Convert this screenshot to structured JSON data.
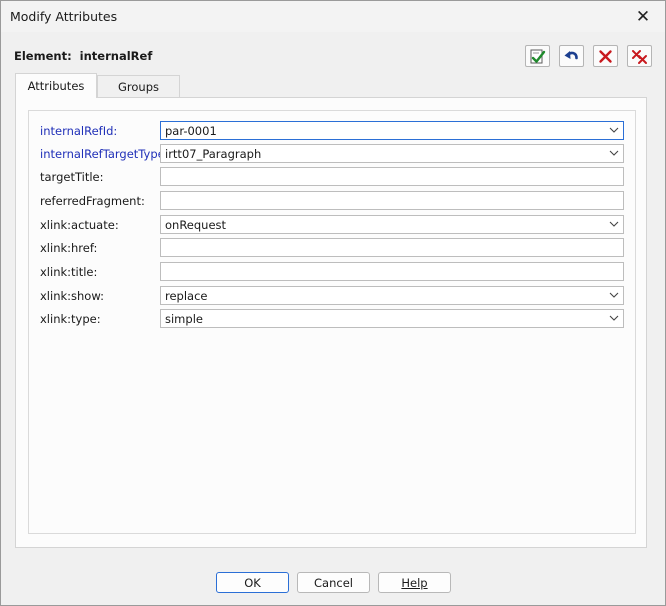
{
  "window": {
    "title": "Modify Attributes",
    "close_glyph": "✕"
  },
  "element": {
    "label": "Element:",
    "name": "internalRef"
  },
  "toolbar": {
    "icons": [
      "check-document-icon",
      "undo-icon",
      "delete-icon",
      "delete-all-icon"
    ]
  },
  "tabs": [
    {
      "label": "Attributes",
      "active": true
    },
    {
      "label": "Groups",
      "active": false
    }
  ],
  "attributes": [
    {
      "label": "internalRefId:",
      "value": "par-0001",
      "type": "select",
      "required": true,
      "focused": true
    },
    {
      "label": "internalRefTargetType:",
      "value": "irtt07_Paragraph",
      "type": "select",
      "required": true,
      "focused": false
    },
    {
      "label": "targetTitle:",
      "value": "",
      "type": "text",
      "required": false,
      "focused": false
    },
    {
      "label": "referredFragment:",
      "value": "",
      "type": "text",
      "required": false,
      "focused": false
    },
    {
      "label": "xlink:actuate:",
      "value": "onRequest",
      "type": "select",
      "required": false,
      "focused": false
    },
    {
      "label": "xlink:href:",
      "value": "",
      "type": "text",
      "required": false,
      "focused": false
    },
    {
      "label": "xlink:title:",
      "value": "",
      "type": "text",
      "required": false,
      "focused": false
    },
    {
      "label": "xlink:show:",
      "value": "replace",
      "type": "select",
      "required": false,
      "focused": false
    },
    {
      "label": "xlink:type:",
      "value": "simple",
      "type": "select",
      "required": false,
      "focused": false
    }
  ],
  "footer": {
    "ok_label": "OK",
    "cancel_label": "Cancel",
    "help_label": "Help"
  },
  "colors": {
    "required_label": "#2030b8",
    "focus_border": "#2b6fd6",
    "check_green": "#1f8a2c",
    "undo_blue": "#1c3f8f",
    "delete_red": "#c8191e"
  }
}
